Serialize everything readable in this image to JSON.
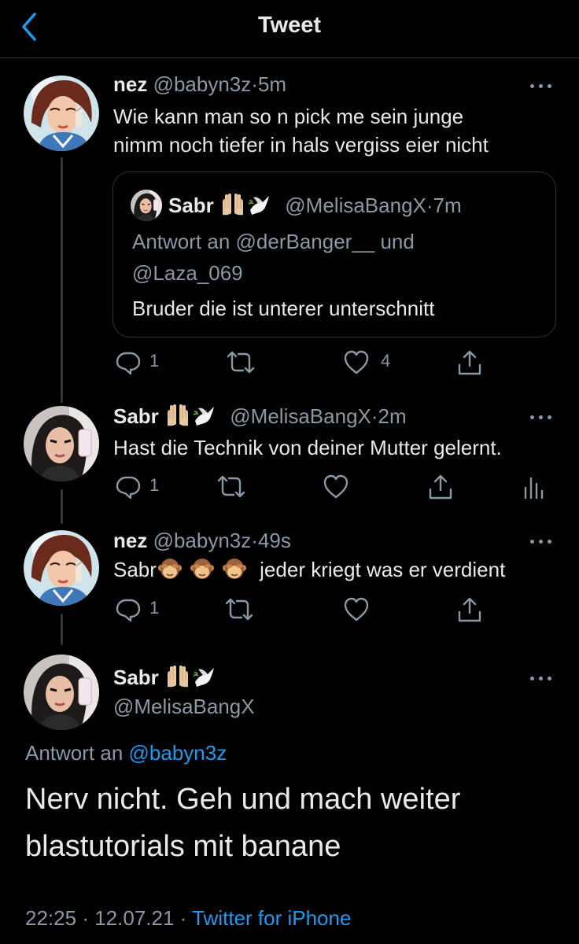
{
  "header": {
    "title": "Tweet"
  },
  "tweet1": {
    "name": "nez",
    "handle": "@babyn3z",
    "sep": "·",
    "time": "5m",
    "text_line1": "Wie kann man so n pick me sein junge",
    "text_line2": "nimm noch tiefer in hals vergiss eier nicht",
    "quote": {
      "name": "Sabr",
      "handle": "@MelisaBangX",
      "sep": "·",
      "time": "7m",
      "reply_prefix": "Antwort an @derBanger__ und",
      "reply_line2": "@Laza_069",
      "text": "Bruder die ist unterer unterschnitt"
    },
    "replies": "1",
    "likes": "4"
  },
  "tweet2": {
    "name": "Sabr",
    "handle": "@MelisaBangX",
    "sep": "·",
    "time": "2m",
    "text": "Hast die Technik von deiner Mutter gelernt.",
    "replies": "1"
  },
  "tweet3": {
    "name": "nez",
    "handle": "@babyn3z",
    "sep": "·",
    "time": "49s",
    "text_prefix": "Sabr",
    "text_suffix": "jeder kriegt was er verdient",
    "replies": "1"
  },
  "main": {
    "name": "Sabr",
    "handle": "@MelisaBangX",
    "reply_label": "Antwort an",
    "reply_handle": "@babyn3z",
    "text_line1": "Nerv nicht. Geh und mach weiter",
    "text_line2": "blastutorials mit banane",
    "time": "22:25",
    "sep1": "·",
    "date": "12.07.21",
    "sep2": "·",
    "source": "Twitter for iPhone"
  },
  "colors": {
    "accent": "#1d9bf0",
    "muted": "#8b98a5",
    "background": "#000000"
  }
}
